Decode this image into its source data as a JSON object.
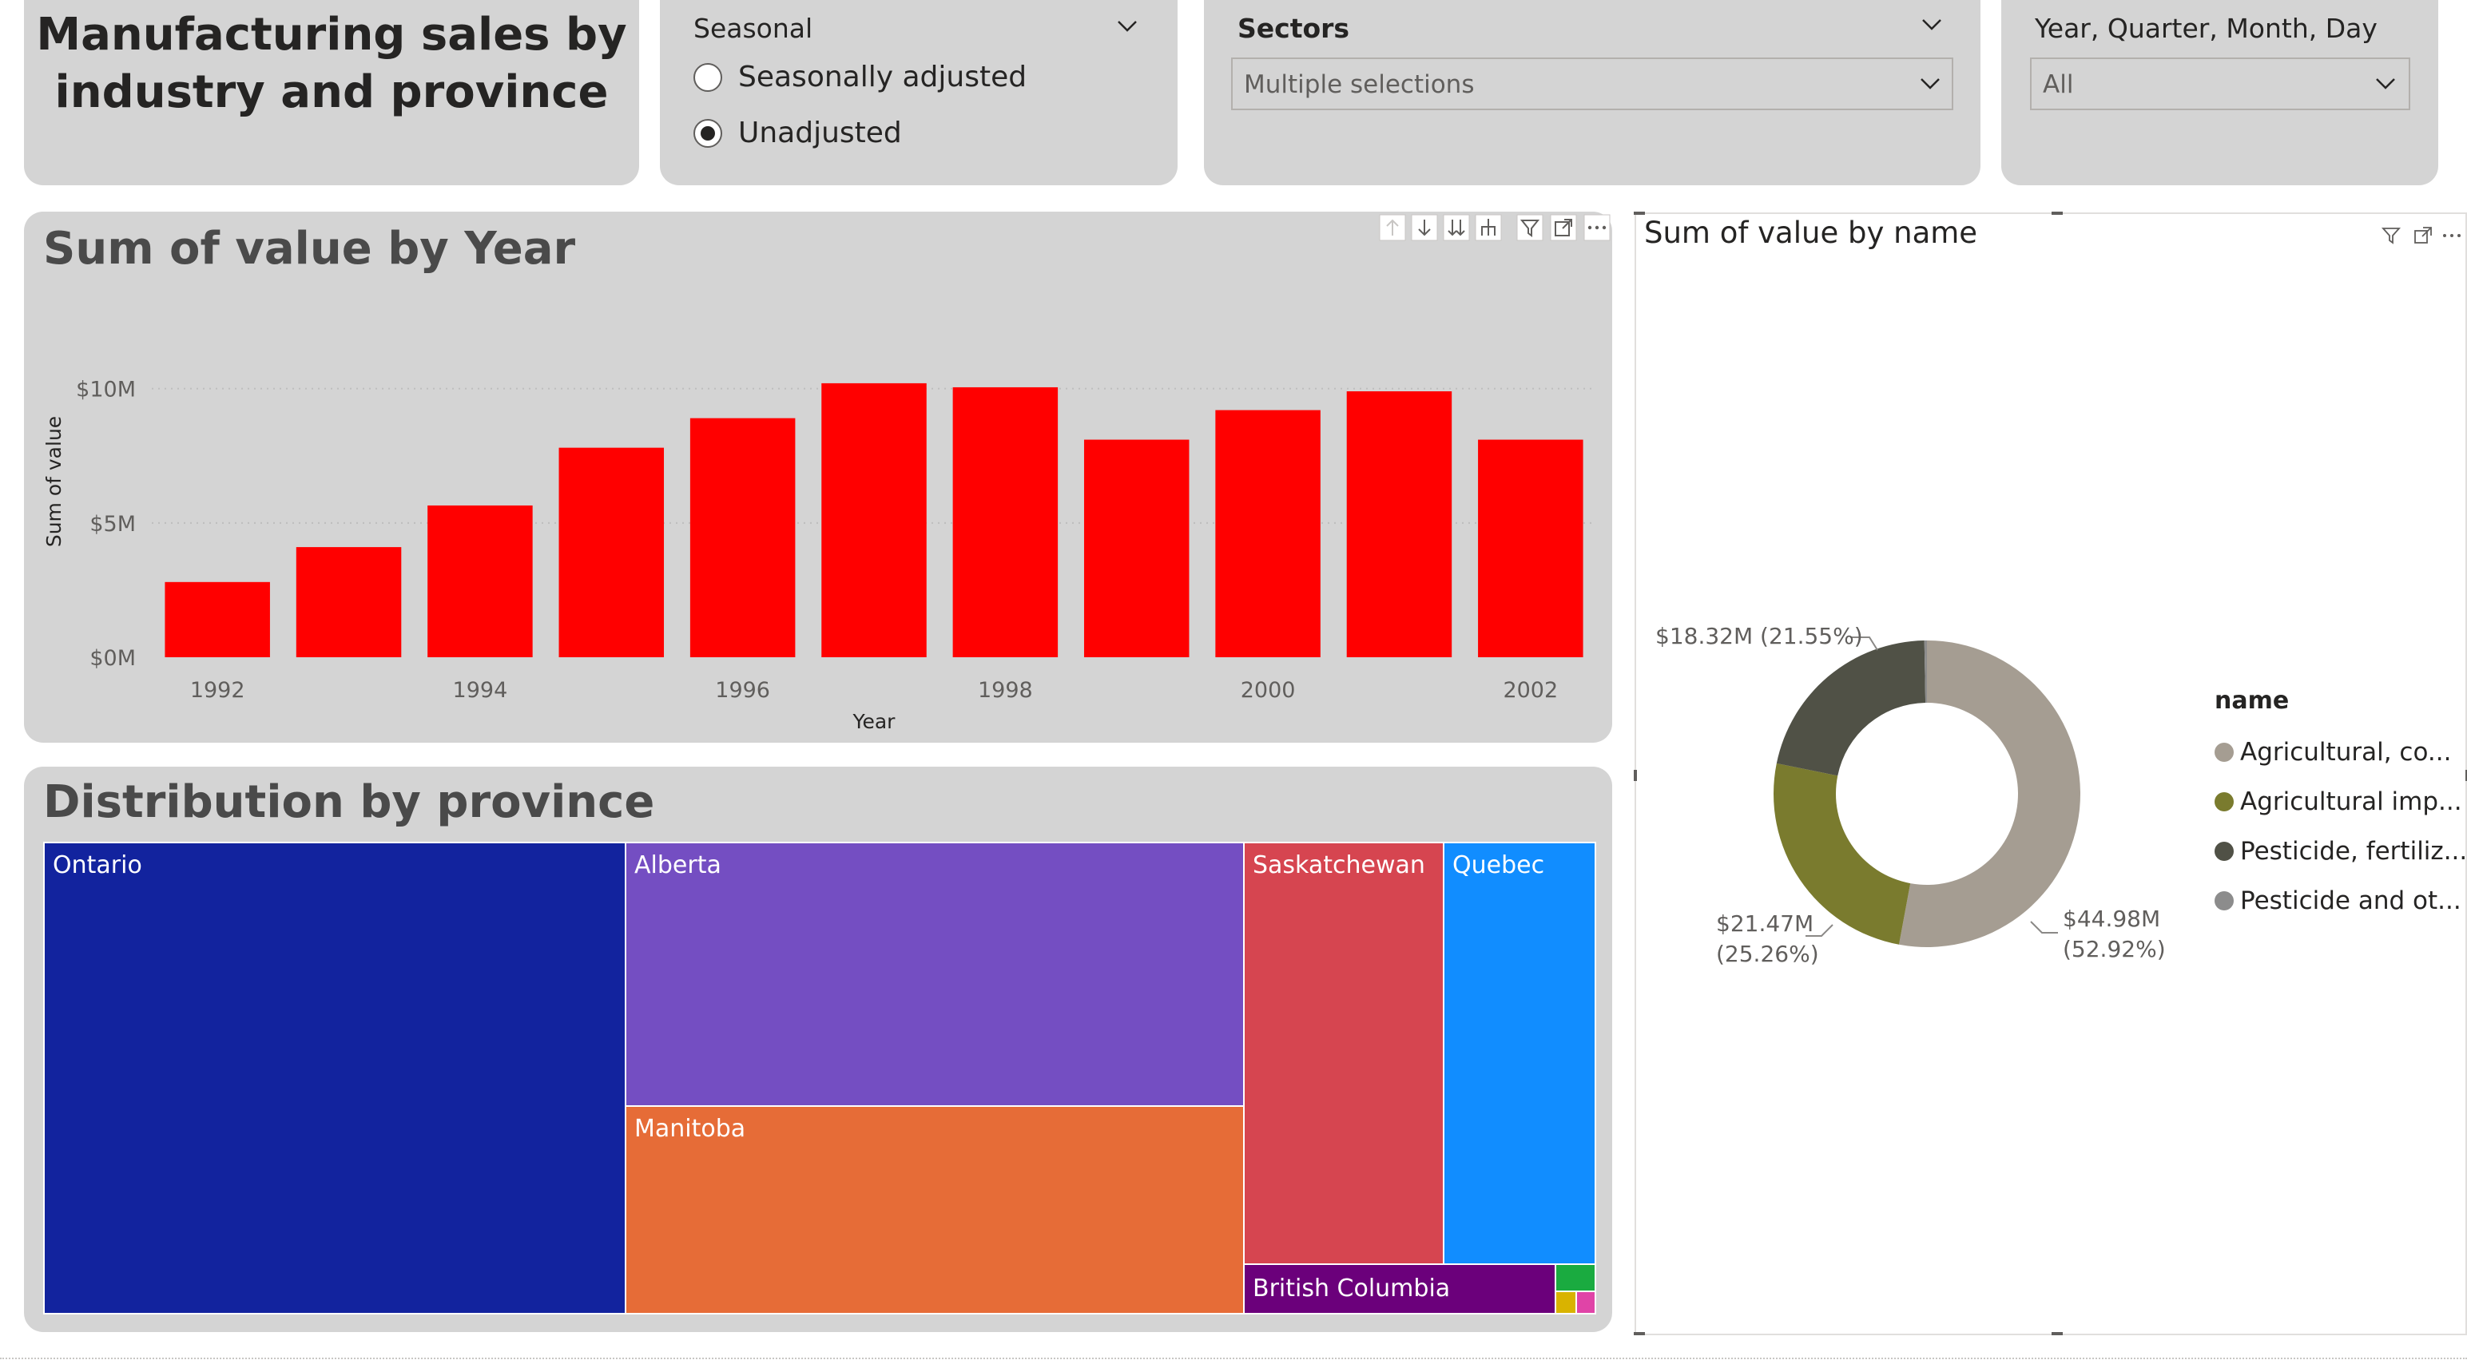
{
  "title_card": {
    "line1": "Manufacturing sales by",
    "line2": "industry and province"
  },
  "seasonal_slicer": {
    "title": "Seasonal",
    "options": [
      {
        "label": "Seasonally adjusted",
        "selected": false
      },
      {
        "label": "Unadjusted",
        "selected": true
      }
    ]
  },
  "sectors_slicer": {
    "title": "Sectors",
    "value": "Multiple selections"
  },
  "date_slicer": {
    "title": "Year, Quarter, Month, Day",
    "value": "All"
  },
  "bar_chart": {
    "title": "Sum of value by Year",
    "icons": [
      "drill-up-icon",
      "drill-down-icon",
      "expand-all-icon",
      "drill-hierarchy-icon",
      "filter-icon",
      "focus-mode-icon",
      "more-options-icon"
    ]
  },
  "treemap": {
    "title": "Distribution by province",
    "tiles": [
      {
        "label": "Ontario",
        "color": "#12239e"
      },
      {
        "label": "Alberta",
        "color": "#744ec2"
      },
      {
        "label": "Manitoba",
        "color": "#e66c37"
      },
      {
        "label": "Saskatchewan",
        "color": "#d64550"
      },
      {
        "label": "Quebec",
        "color": "#118dff"
      },
      {
        "label": "British Columbia",
        "color": "#6b007b"
      },
      {
        "label": "",
        "color": "#1aab40"
      },
      {
        "label": "",
        "color": "#d9b300"
      },
      {
        "label": "",
        "color": "#e044a7"
      }
    ]
  },
  "donut_chart": {
    "title": "Sum of value by name",
    "legend_title": "name",
    "labels": {
      "slice0_value": "$44.98M",
      "slice0_pct": "(52.92%)",
      "slice1_value": "$21.47M",
      "slice1_pct": "(25.26%)",
      "slice2": "$18.32M (21.55%)"
    },
    "legend": [
      {
        "label": "Agricultural, co...",
        "color": "#a59d92"
      },
      {
        "label": "Agricultural imp...",
        "color": "#7a7b2e"
      },
      {
        "label": "Pesticide, fertiliz...",
        "color": "#505146"
      },
      {
        "label": "Pesticide and ot...",
        "color": "#8c8c8c"
      }
    ]
  },
  "chart_data": [
    {
      "type": "bar",
      "title": "Sum of value by Year",
      "xlabel": "Year",
      "ylabel": "Sum of value",
      "x": [
        1992,
        1993,
        1994,
        1995,
        1996,
        1997,
        1998,
        1999,
        2000,
        2001,
        2002
      ],
      "x_tick_labels": [
        "1992",
        "1994",
        "1996",
        "1998",
        "2000",
        "2002"
      ],
      "values": [
        2800000,
        4100000,
        5650000,
        7800000,
        8900000,
        10200000,
        10050000,
        8100000,
        9200000,
        9900000,
        8100000
      ],
      "y_tick_labels": [
        "$0M",
        "$5M",
        "$10M"
      ],
      "y_ticks": [
        0,
        5000000,
        10000000
      ],
      "ylim": [
        0,
        11000000
      ],
      "color": "#ff0000",
      "grid": true
    },
    {
      "type": "pie",
      "title": "Sum of value by name",
      "legend_title": "name",
      "categories": [
        "Agricultural, co...",
        "Agricultural imp...",
        "Pesticide, fertiliz...",
        "Pesticide and ot..."
      ],
      "values": [
        44.98,
        21.47,
        18.32,
        0.23
      ],
      "percentages": [
        52.92,
        25.26,
        21.55,
        0.27
      ],
      "colors": [
        "#a59d92",
        "#7a7b2e",
        "#505146",
        "#8c8c8c"
      ],
      "legend": "right"
    },
    {
      "type": "treemap",
      "title": "Distribution by province",
      "categories": [
        "Ontario",
        "Alberta",
        "Manitoba",
        "Saskatchewan",
        "Quebec",
        "British Columbia"
      ]
    }
  ]
}
